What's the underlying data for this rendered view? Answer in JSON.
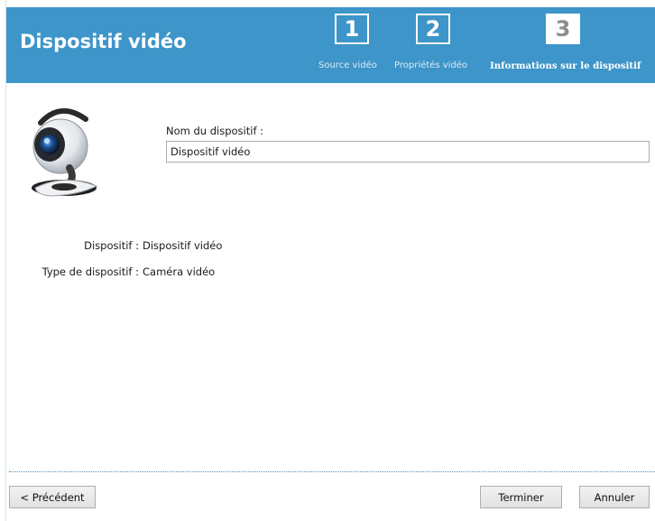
{
  "header": {
    "title": "Dispositif vidéo",
    "steps": [
      {
        "number": "1",
        "label": "Source vidéo",
        "active": false
      },
      {
        "number": "2",
        "label": "Propriétés vidéo",
        "active": false
      },
      {
        "number": "3",
        "label": "Informations sur le dispositif",
        "active": true
      }
    ]
  },
  "form": {
    "name_label": "Nom du dispositif :",
    "name_value": "Dispositif vidéo"
  },
  "info": [
    {
      "key": "Dispositif :",
      "value": "Dispositif vidéo"
    },
    {
      "key": "Type de dispositif :",
      "value": "Caméra vidéo"
    }
  ],
  "footer": {
    "previous_label": "< Précédent",
    "finish_label": "Terminer",
    "cancel_label": "Annuler"
  },
  "colors": {
    "header_bg": "#3d95c9",
    "step_text": "#ffffff",
    "active_step_number": "#8d8d8d"
  },
  "icons": {
    "device": "webcam-icon"
  }
}
